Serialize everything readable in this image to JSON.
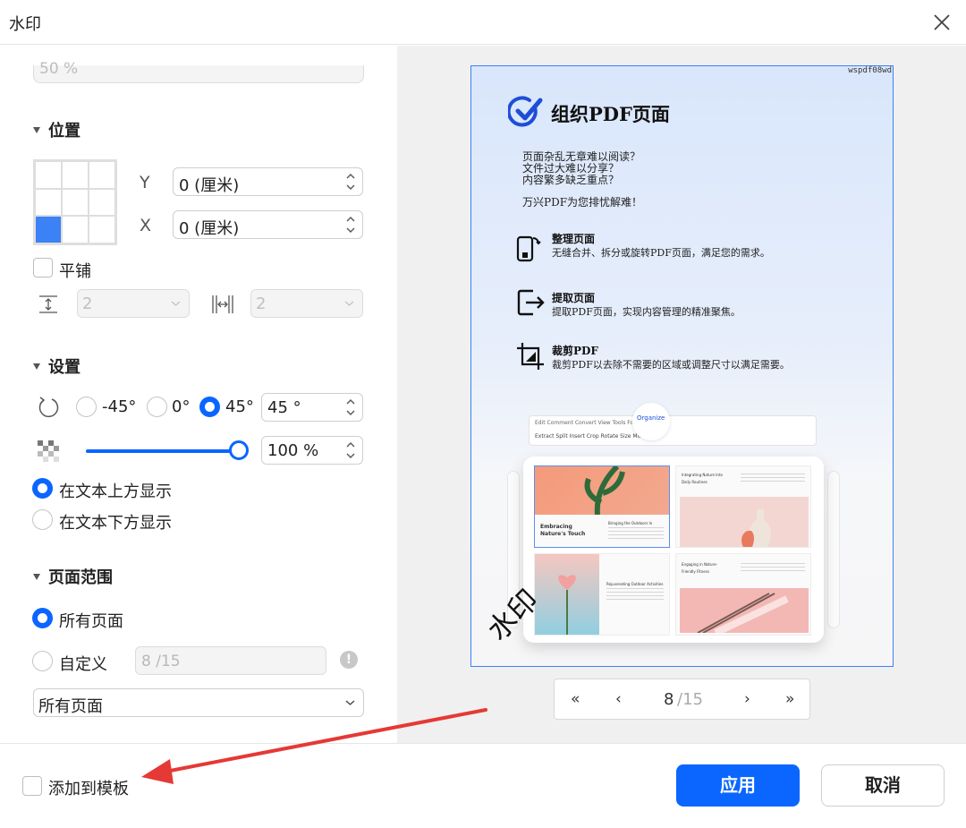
{
  "window": {
    "title": "水印"
  },
  "left": {
    "top_partial_value": "50 %",
    "position": {
      "heading": "位置",
      "y_label": "Y",
      "y_value": "0 (厘米)",
      "x_label": "X",
      "x_value": "0 (厘米)",
      "grid_selected": "bottom-left",
      "tile_label": "平铺",
      "tile_rows": "2",
      "tile_cols": "2"
    },
    "settings": {
      "heading": "设置",
      "rotation_options": [
        "-45°",
        "0°",
        "45°"
      ],
      "rotation_selected": "45°",
      "rotation_value": "45 °",
      "opacity_value": "100 %",
      "opacity_fraction": 1.0,
      "layer_above": "在文本上方显示",
      "layer_below": "在文本下方显示",
      "layer_selected": "above"
    },
    "page_range": {
      "heading": "页面范围",
      "all_pages": "所有页面",
      "custom": "自定义",
      "custom_current": "8",
      "custom_total": "/15",
      "subset_select": "所有页面"
    }
  },
  "preview": {
    "doc_code": "wspdf08wd",
    "title": "组织PDF页面",
    "lines": [
      "页面杂乱无章难以阅读？",
      "文件过大难以分享？",
      "内容繁多缺乏重点？"
    ],
    "tagline": "万兴PDF为您排忧解难！",
    "features": [
      {
        "title": "整理页面",
        "desc": "无缝合并、拆分或旋转PDF页面，满足您的需求。"
      },
      {
        "title": "提取页面",
        "desc": "提取PDF页面，实现内容管理的精准聚焦。"
      },
      {
        "title": "裁剪PDF",
        "desc": "裁剪PDF以去除不需要的区域或调整尺寸以满足需要。"
      }
    ],
    "mock": {
      "tabs": "Edit   Comment   Convert   View                    Tools   Form   Protect",
      "active_tab": "Organize",
      "tools": "Extract   Split      Insert        Crop     Rotate        Size     More",
      "tile1_caption": "Embracing\nNature's Touch",
      "tile1_sub": "Bringing the Outdoors In",
      "tile2_sub": "Integrating Nature Into\nDaily Routines",
      "tile3_sub": "Rejuvenating Outdoor Activities",
      "tile4_sub": "Engaging in Nature-\nFriendly Fitness"
    },
    "watermark_text": "水印",
    "pager": {
      "first": "«",
      "prev": "‹",
      "current": "8",
      "total": "/15",
      "next": "›",
      "last": "»"
    }
  },
  "footer": {
    "add_template": "添加到模板",
    "apply": "应用",
    "cancel": "取消"
  },
  "colors": {
    "accent": "#0a66ff",
    "annotation_arrow": "#e53935"
  }
}
